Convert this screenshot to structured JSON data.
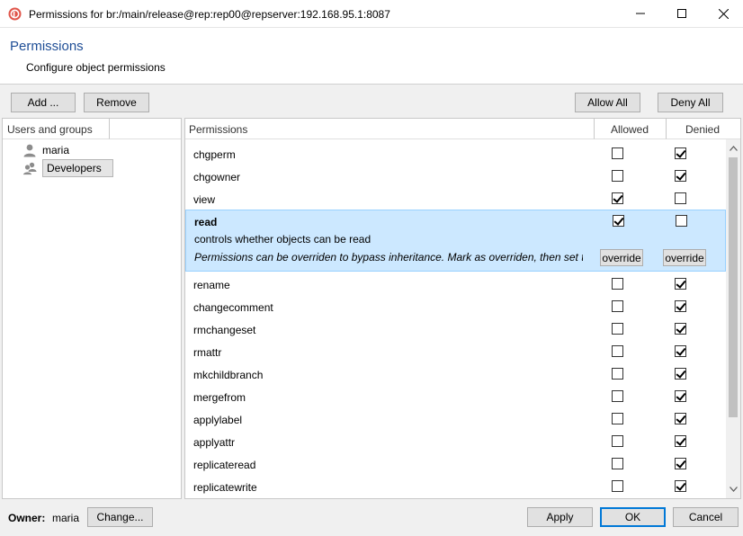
{
  "window": {
    "title": "Permissions for br:/main/release@rep:rep00@repserver:192.168.95.1:8087"
  },
  "header": {
    "title": "Permissions",
    "subtitle": "Configure object permissions"
  },
  "toolbar": {
    "add_label": "Add ...",
    "remove_label": "Remove",
    "allow_all_label": "Allow All",
    "deny_all_label": "Deny All"
  },
  "users_panel": {
    "header": "Users and groups",
    "items": [
      {
        "label": "maria",
        "type": "user",
        "icon": "user-icon"
      },
      {
        "label": "Developers",
        "type": "group",
        "icon": "group-icon",
        "selected": true
      }
    ]
  },
  "permissions_panel": {
    "headers": {
      "permission": "Permissions",
      "allowed": "Allowed",
      "denied": "Denied"
    },
    "rows": [
      {
        "name": "chgperm",
        "allowed": false,
        "denied": true
      },
      {
        "name": "chgowner",
        "allowed": false,
        "denied": true
      },
      {
        "name": "view",
        "allowed": true,
        "denied": false
      },
      {
        "name": "read",
        "allowed": true,
        "denied": false,
        "selected": true
      },
      {
        "name": "rename",
        "allowed": false,
        "denied": true
      },
      {
        "name": "changecomment",
        "allowed": false,
        "denied": true
      },
      {
        "name": "rmchangeset",
        "allowed": false,
        "denied": true
      },
      {
        "name": "rmattr",
        "allowed": false,
        "denied": true
      },
      {
        "name": "mkchildbranch",
        "allowed": false,
        "denied": true
      },
      {
        "name": "mergefrom",
        "allowed": false,
        "denied": true
      },
      {
        "name": "applylabel",
        "allowed": false,
        "denied": true
      },
      {
        "name": "applyattr",
        "allowed": false,
        "denied": true
      },
      {
        "name": "replicateread",
        "allowed": false,
        "denied": true
      },
      {
        "name": "replicatewrite",
        "allowed": false,
        "denied": true
      }
    ],
    "selected_detail": {
      "description": "controls whether objects can be read",
      "note": "Permissions can be overriden to bypass inheritance. Mark as overriden, then set t...",
      "override_label": "override"
    }
  },
  "footer": {
    "owner_label": "Owner:",
    "owner_value": "maria",
    "change_label": "Change...",
    "apply_label": "Apply",
    "ok_label": "OK",
    "cancel_label": "Cancel"
  },
  "colors": {
    "accent": "#0078d7",
    "header_title": "#1f4e96",
    "selection_bg": "#cce8ff",
    "selection_border": "#99d1ff",
    "app_icon": "#e0554a"
  }
}
